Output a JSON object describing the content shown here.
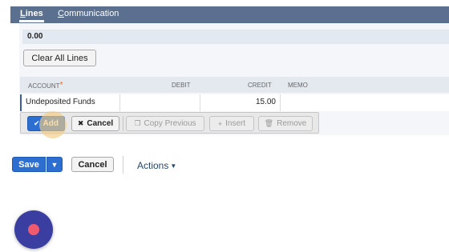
{
  "tabs": {
    "lines_first": "L",
    "lines_rest": "ines",
    "communication_first": "C",
    "communication_rest": "ommunication"
  },
  "totals": {
    "value": "0.00"
  },
  "clear_all_lines": "Clear All Lines",
  "grid": {
    "headers": {
      "account": "ACCOUNT",
      "required_mark": "*",
      "debit": "DEBIT",
      "credit": "CREDIT",
      "memo": "MEMO"
    },
    "row": {
      "account": "Undeposited Funds",
      "debit": "",
      "credit": "15.00",
      "memo": ""
    }
  },
  "line_actions": {
    "add": "Add",
    "cancel": "Cancel",
    "copy_previous": "Copy Previous",
    "insert": "Insert",
    "remove": "Remove"
  },
  "icons": {
    "add": "check-icon",
    "cancel": "x-icon",
    "copy_previous": "copy-icon",
    "insert": "plus-icon",
    "remove": "trash-icon",
    "save_dropdown": "caret-down-icon",
    "actions_caret": "caret-down-icon",
    "record": "record-icon"
  },
  "form_actions": {
    "save": "Save",
    "cancel": "Cancel",
    "actions": "Actions"
  },
  "colors": {
    "primary": "#2c6fd1",
    "tabbar": "#5b6f8e",
    "header_bg": "#e4e9f0",
    "record": "#3b3ea1",
    "record_dot": "#ef5a6e"
  }
}
